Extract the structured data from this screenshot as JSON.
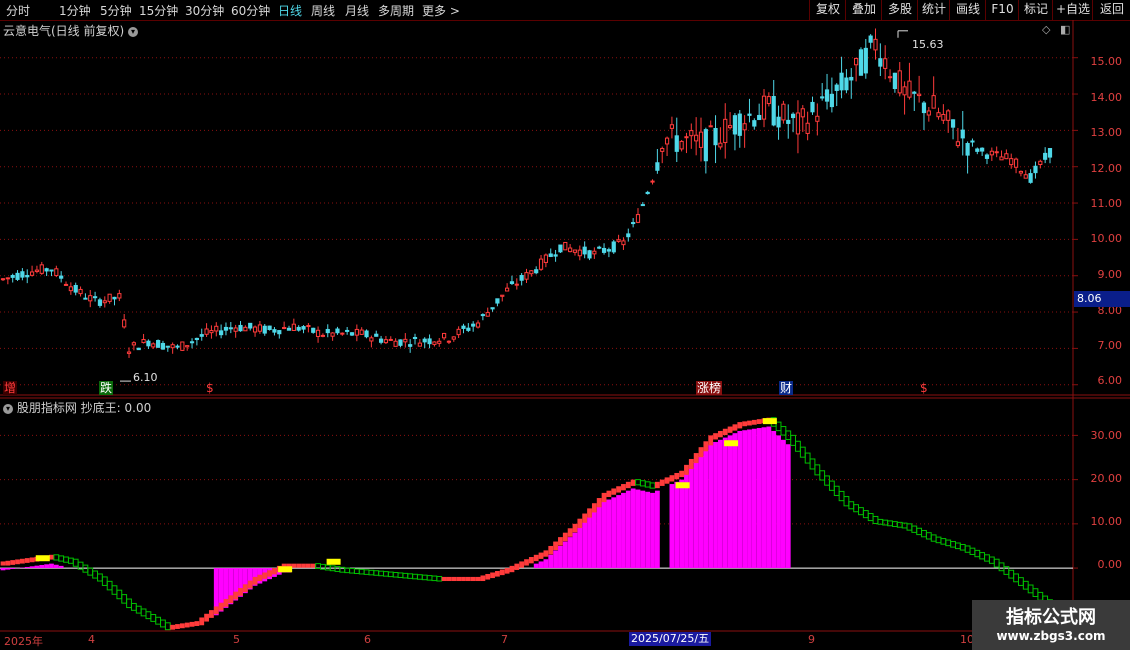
{
  "toolbar": {
    "periods": [
      "分时",
      "1分钟",
      "5分钟",
      "15分钟",
      "30分钟",
      "60分钟",
      "日线",
      "周线",
      "月线",
      "多周期",
      "更多"
    ],
    "active_period": "日线",
    "more_arrow": ">",
    "right_buttons": [
      "复权",
      "叠加",
      "多股",
      "统计",
      "画线",
      "F10",
      "标记",
      "+自选",
      "返回"
    ]
  },
  "stock": {
    "title": "云意电气(日线 前复权)",
    "high_label": "15.63",
    "low_label": "6.10",
    "current_price": "8.06"
  },
  "indicator": {
    "title": "股朋指标网 抄底王: 0.00"
  },
  "price_axis": [
    "15.00",
    "14.00",
    "13.00",
    "12.00",
    "11.00",
    "10.00",
    "9.00",
    "8.00",
    "7.00",
    "6.00"
  ],
  "indicator_axis": [
    "30.00",
    "20.00",
    "10.00",
    "0.00"
  ],
  "date_axis": {
    "labels": [
      "2025年",
      "4",
      "5",
      "6",
      "7",
      "9",
      "10"
    ],
    "selected_date": "2025/07/25/五"
  },
  "tags": [
    "增",
    "跌",
    "$",
    "涨榜",
    "财",
    "$"
  ],
  "watermark": {
    "title": "指标公式网",
    "url": "www.zbgs3.com"
  },
  "colors": {
    "up": "#ff3b3b",
    "down": "#4fd8e8",
    "grid": "#8a1010",
    "magenta": "#ff00ff",
    "yellow": "#ffff00",
    "green_box": "#00c000"
  },
  "chart_data": {
    "type": "candlestick",
    "price_ylim": [
      5.8,
      15.9
    ],
    "price_high": 15.63,
    "price_low": 6.1,
    "indicator_ylim": [
      -14,
      38
    ],
    "indicator_value": 0.0
  }
}
